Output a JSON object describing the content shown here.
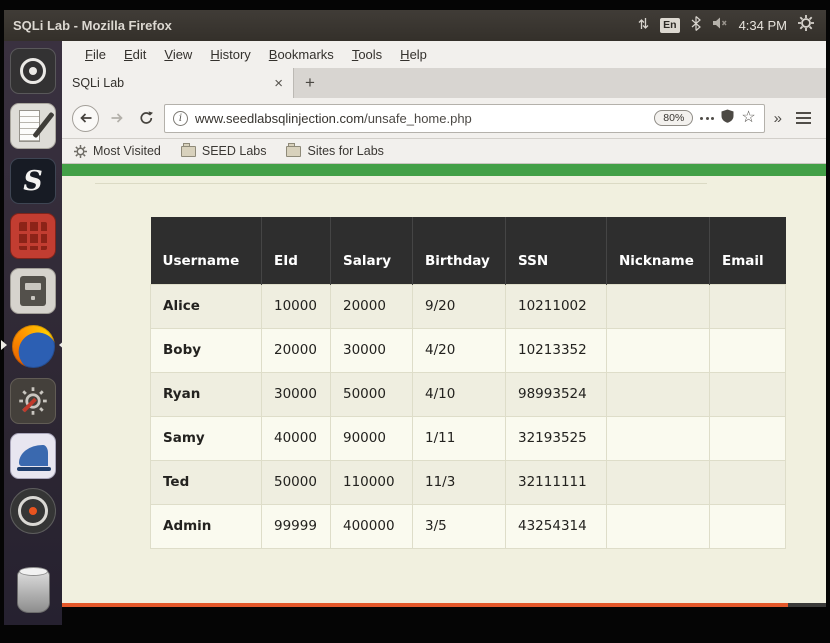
{
  "colors": {
    "page_green": "#43a047",
    "ubuntu_orange": "#e4582a",
    "table_header_bg": "#2e2e2e"
  },
  "panel": {
    "title": "SQLi Lab - Mozilla Firefox",
    "language_badge": "En",
    "clock": "4:34 PM",
    "tray_icons": [
      "keyboard-indicator",
      "language-indicator",
      "bluetooth",
      "volume-muted",
      "clock",
      "session-gear"
    ]
  },
  "launcher": {
    "items": [
      "ubuntu-dash",
      "text-editor",
      "seed-terminal-s",
      "red-grid-app",
      "file-cabinet",
      "firefox",
      "system-tools",
      "wireshark",
      "software-center",
      "trash"
    ]
  },
  "firefox": {
    "menubar": [
      "File",
      "Edit",
      "View",
      "History",
      "Bookmarks",
      "Tools",
      "Help"
    ],
    "tab": {
      "title": "SQLi Lab",
      "close_glyph": "×",
      "new_tab_glyph": "+"
    },
    "navbar": {
      "url_domain": "www.seedlabsqlinjection.com",
      "url_path": "/unsafe_home.php",
      "zoom": "80%",
      "overflow_glyph": "»",
      "star_glyph": "☆"
    },
    "bookmarks": [
      "Most Visited",
      "SEED Labs",
      "Sites for Labs"
    ]
  },
  "page": {
    "table": {
      "headers": [
        "Username",
        "EId",
        "Salary",
        "Birthday",
        "SSN",
        "Nickname",
        "Email"
      ],
      "rows": [
        [
          "Alice",
          "10000",
          "20000",
          "9/20",
          "10211002",
          "",
          ""
        ],
        [
          "Boby",
          "20000",
          "30000",
          "4/20",
          "10213352",
          "",
          ""
        ],
        [
          "Ryan",
          "30000",
          "50000",
          "4/10",
          "98993524",
          "",
          ""
        ],
        [
          "Samy",
          "40000",
          "90000",
          "1/11",
          "32193525",
          "",
          ""
        ],
        [
          "Ted",
          "50000",
          "110000",
          "11/3",
          "32111111",
          "",
          ""
        ],
        [
          "Admin",
          "99999",
          "400000",
          "3/5",
          "43254314",
          "",
          ""
        ]
      ]
    }
  }
}
